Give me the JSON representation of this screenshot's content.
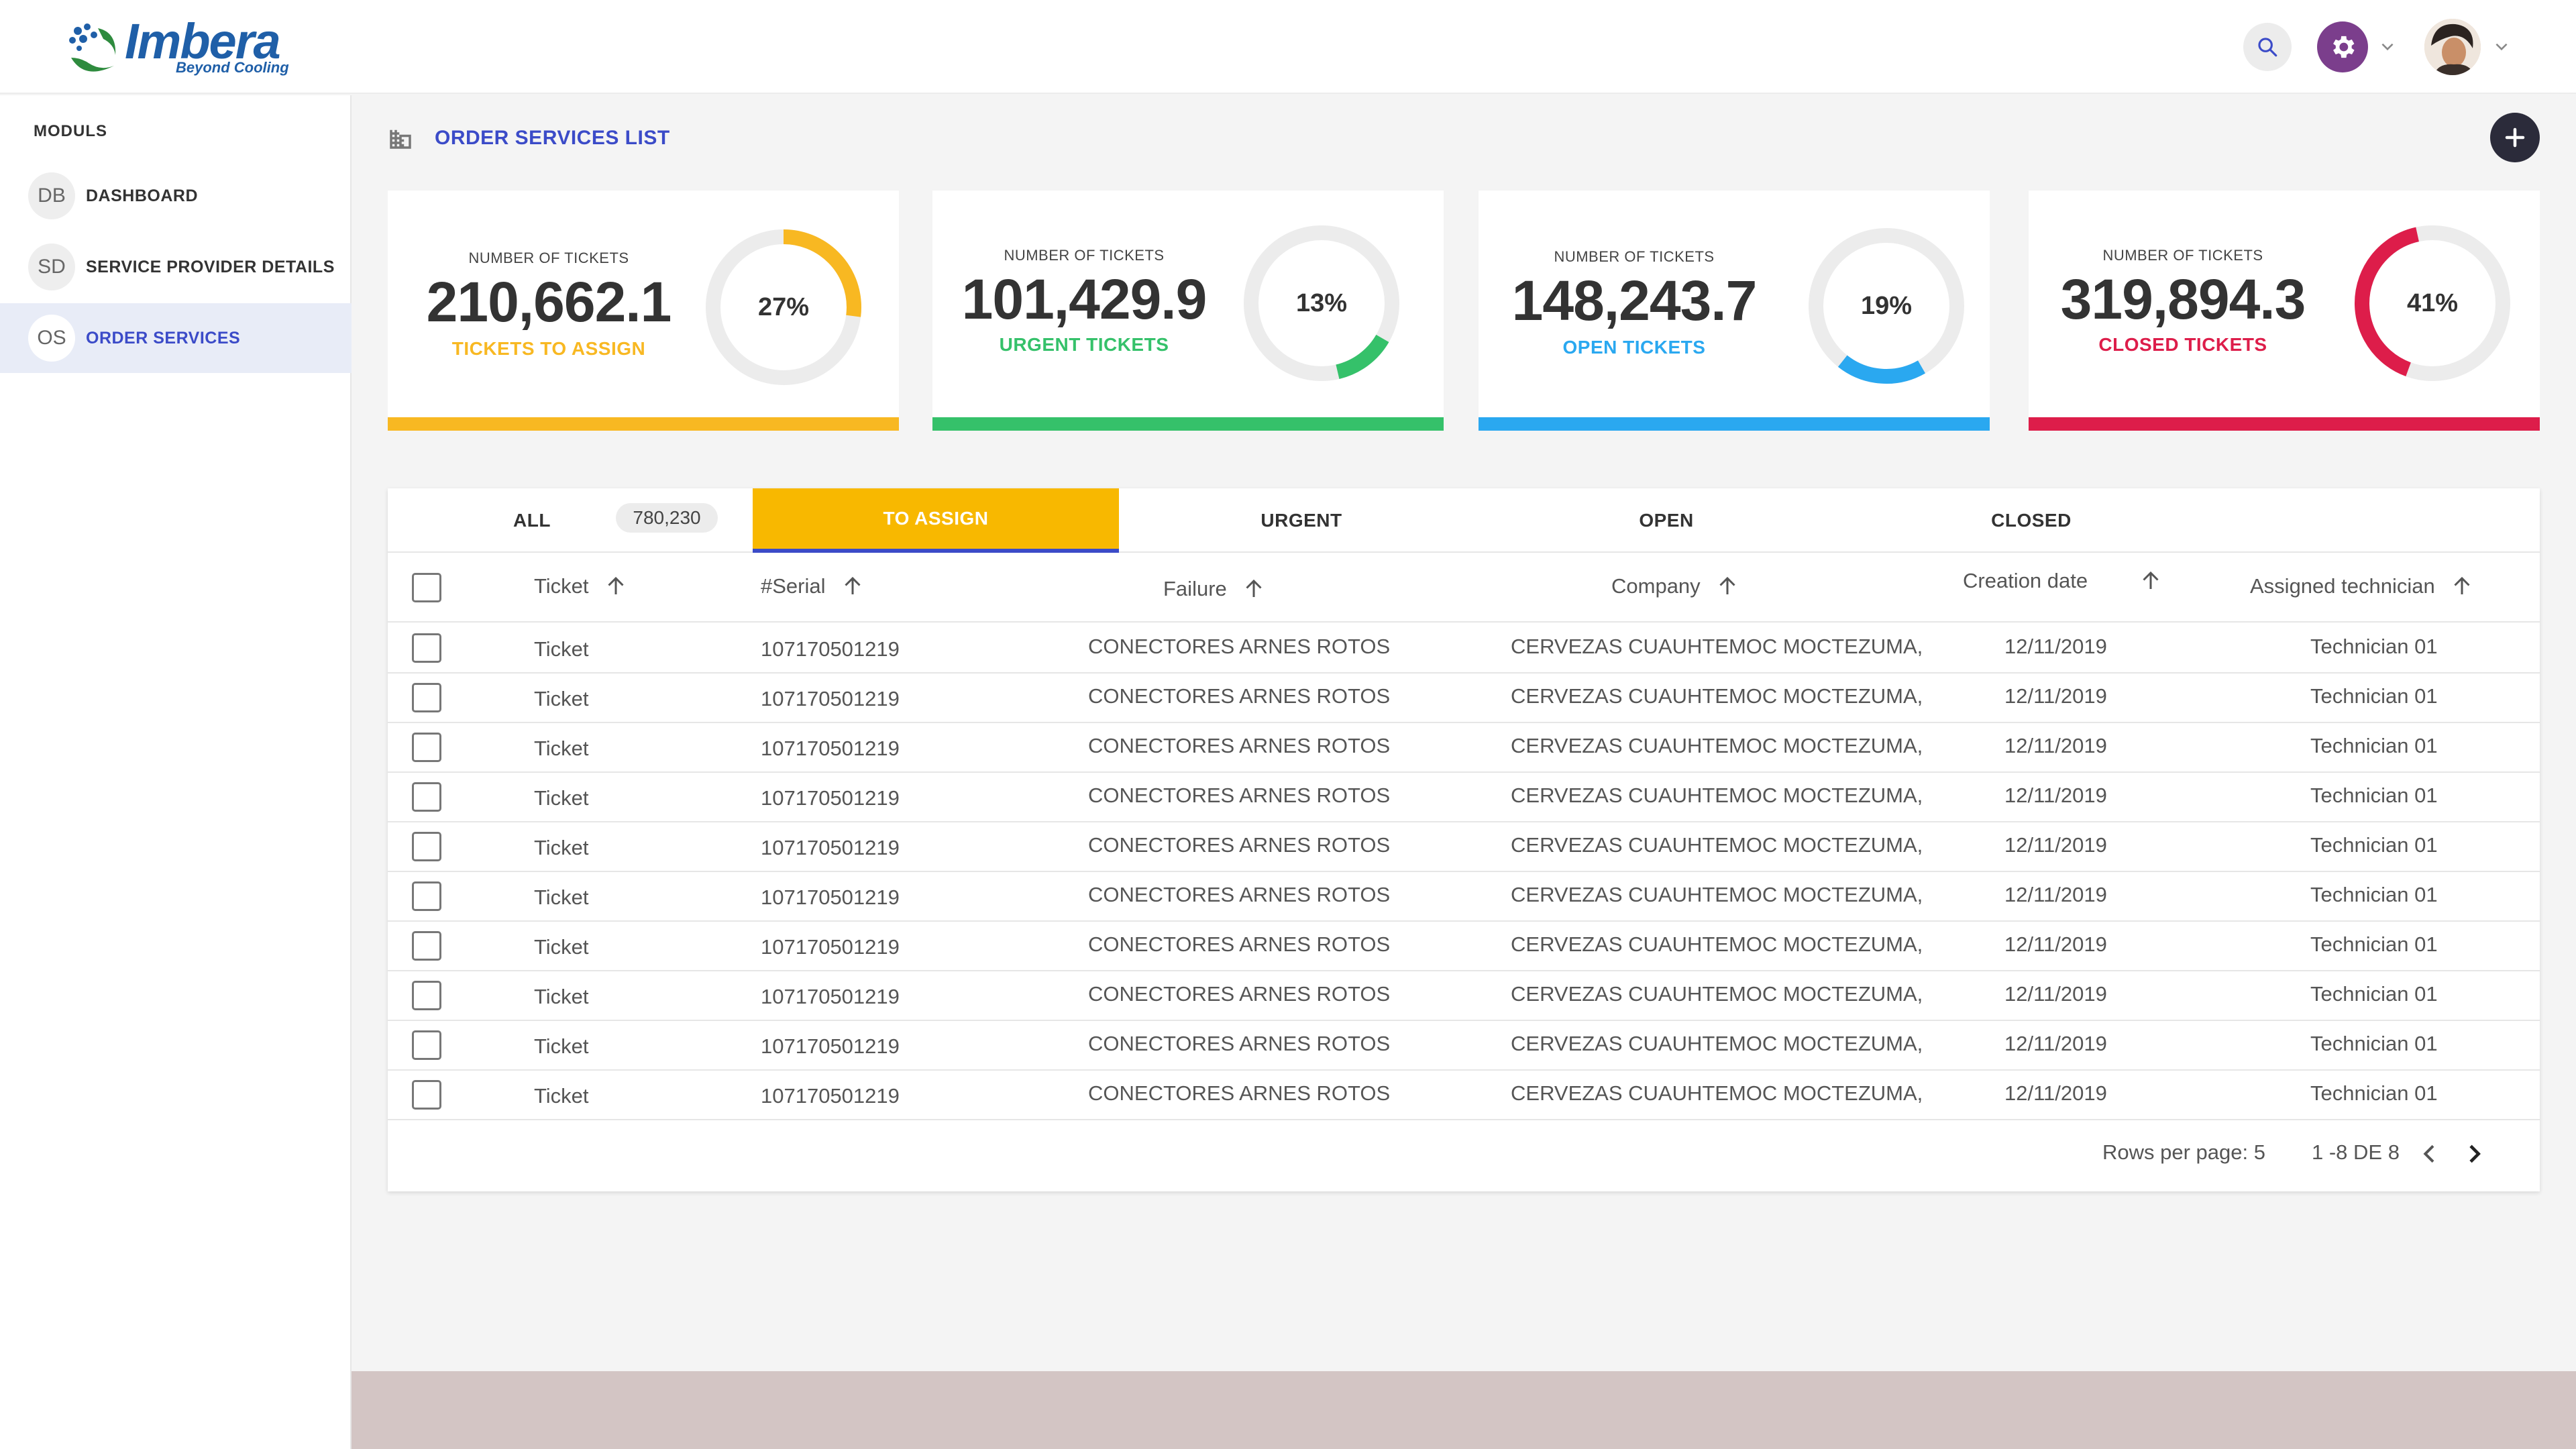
{
  "header": {
    "logo_name": "Imbera",
    "logo_tagline": "Beyond Cooling",
    "icons": [
      "search-icon",
      "gear-icon",
      "chevron-down-icon",
      "avatar"
    ]
  },
  "sidebar": {
    "title": "MODULS",
    "items": [
      {
        "badge": "DB",
        "label": "DASHBOARD",
        "active": false
      },
      {
        "badge": "SD",
        "label": "SERVICE PROVIDER DETAILS",
        "active": false
      },
      {
        "badge": "OS",
        "label": "ORDER SERVICES",
        "active": true
      }
    ]
  },
  "page": {
    "title": "ORDER SERVICES LIST"
  },
  "cards": [
    {
      "caption": "NUMBER OF TICKETS",
      "value": "210,662.1",
      "label": "TICKETS TO ASSIGN",
      "percent": "27%",
      "fraction": 0.27,
      "color": "#f8b822"
    },
    {
      "caption": "NUMBER OF TICKETS",
      "value": "101,429.9",
      "label": "URGENT TICKETS",
      "percent": "13%",
      "fraction": 0.13,
      "color": "#35c16a"
    },
    {
      "caption": "NUMBER OF TICKETS",
      "value": "148,243.7",
      "label": "OPEN TICKETS",
      "percent": "19%",
      "fraction": 0.19,
      "color": "#2aa8f0"
    },
    {
      "caption": "NUMBER OF TICKETS",
      "value": "319,894.3",
      "label": "CLOSED TICKETS",
      "percent": "41%",
      "fraction": 0.41,
      "color": "#dd1d4a"
    }
  ],
  "tabs": [
    {
      "label": "ALL",
      "count": "780,230",
      "active": false
    },
    {
      "label": "TO ASSIGN",
      "active": true
    },
    {
      "label": "URGENT",
      "active": false
    },
    {
      "label": "OPEN",
      "active": false
    },
    {
      "label": "CLOSED",
      "active": false
    }
  ],
  "table": {
    "columns": [
      "Ticket",
      "#Serial",
      "Failure",
      "Company",
      "Creation date",
      "Assigned technician"
    ],
    "rows": [
      [
        "Ticket",
        "107170501219",
        "CONECTORES ARNES ROTOS",
        "CERVEZAS CUAUHTEMOC MOCTEZUMA,",
        "12/11/2019",
        "Technician 01"
      ],
      [
        "Ticket",
        "107170501219",
        "CONECTORES ARNES ROTOS",
        "CERVEZAS CUAUHTEMOC MOCTEZUMA,",
        "12/11/2019",
        "Technician 01"
      ],
      [
        "Ticket",
        "107170501219",
        "CONECTORES ARNES ROTOS",
        "CERVEZAS CUAUHTEMOC MOCTEZUMA,",
        "12/11/2019",
        "Technician 01"
      ],
      [
        "Ticket",
        "107170501219",
        "CONECTORES ARNES ROTOS",
        "CERVEZAS CUAUHTEMOC MOCTEZUMA,",
        "12/11/2019",
        "Technician 01"
      ],
      [
        "Ticket",
        "107170501219",
        "CONECTORES ARNES ROTOS",
        "CERVEZAS CUAUHTEMOC MOCTEZUMA,",
        "12/11/2019",
        "Technician 01"
      ],
      [
        "Ticket",
        "107170501219",
        "CONECTORES ARNES ROTOS",
        "CERVEZAS CUAUHTEMOC MOCTEZUMA,",
        "12/11/2019",
        "Technician 01"
      ],
      [
        "Ticket",
        "107170501219",
        "CONECTORES ARNES ROTOS",
        "CERVEZAS CUAUHTEMOC MOCTEZUMA,",
        "12/11/2019",
        "Technician 01"
      ],
      [
        "Ticket",
        "107170501219",
        "CONECTORES ARNES ROTOS",
        "CERVEZAS CUAUHTEMOC MOCTEZUMA,",
        "12/11/2019",
        "Technician 01"
      ],
      [
        "Ticket",
        "107170501219",
        "CONECTORES ARNES ROTOS",
        "CERVEZAS CUAUHTEMOC MOCTEZUMA,",
        "12/11/2019",
        "Technician 01"
      ],
      [
        "Ticket",
        "107170501219",
        "CONECTORES ARNES ROTOS",
        "CERVEZAS CUAUHTEMOC MOCTEZUMA,",
        "12/11/2019",
        "Technician 01"
      ]
    ]
  },
  "pagination": {
    "rows_per_page": "Rows per page: 5",
    "range": "1 -8 DE 8"
  },
  "colors": {
    "accent": "#3b4bc8",
    "tab_active": "#f8b800",
    "gear_button": "#7b3e8c"
  }
}
